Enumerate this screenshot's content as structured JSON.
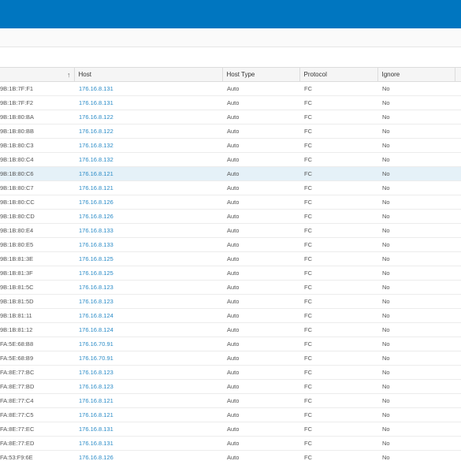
{
  "table": {
    "headers": {
      "port": "",
      "host": "Host",
      "host_type": "Host Type",
      "protocol": "Protocol",
      "ignore": "Ignore"
    },
    "rows": [
      {
        "port": "9B:1B:7F:F1",
        "host": "176.16.8.131",
        "host_type": "Auto",
        "protocol": "FC",
        "ignore": "No"
      },
      {
        "port": "9B:1B:7F:F2",
        "host": "176.16.8.131",
        "host_type": "Auto",
        "protocol": "FC",
        "ignore": "No"
      },
      {
        "port": "9B:1B:80:BA",
        "host": "176.16.8.122",
        "host_type": "Auto",
        "protocol": "FC",
        "ignore": "No"
      },
      {
        "port": "9B:1B:80:BB",
        "host": "176.16.8.122",
        "host_type": "Auto",
        "protocol": "FC",
        "ignore": "No"
      },
      {
        "port": "9B:1B:80:C3",
        "host": "176.16.8.132",
        "host_type": "Auto",
        "protocol": "FC",
        "ignore": "No"
      },
      {
        "port": "9B:1B:80:C4",
        "host": "176.16.8.132",
        "host_type": "Auto",
        "protocol": "FC",
        "ignore": "No"
      },
      {
        "port": "9B:1B:80:C6",
        "host": "176.16.8.121",
        "host_type": "Auto",
        "protocol": "FC",
        "ignore": "No",
        "selected": true
      },
      {
        "port": "9B:1B:80:C7",
        "host": "176.16.8.121",
        "host_type": "Auto",
        "protocol": "FC",
        "ignore": "No"
      },
      {
        "port": "9B:1B:80:CC",
        "host": "176.16.8.126",
        "host_type": "Auto",
        "protocol": "FC",
        "ignore": "No"
      },
      {
        "port": "9B:1B:80:CD",
        "host": "176.16.8.126",
        "host_type": "Auto",
        "protocol": "FC",
        "ignore": "No"
      },
      {
        "port": "9B:1B:80:E4",
        "host": "176.16.8.133",
        "host_type": "Auto",
        "protocol": "FC",
        "ignore": "No"
      },
      {
        "port": "9B:1B:80:E5",
        "host": "176.16.8.133",
        "host_type": "Auto",
        "protocol": "FC",
        "ignore": "No"
      },
      {
        "port": "9B:1B:81:3E",
        "host": "176.16.8.125",
        "host_type": "Auto",
        "protocol": "FC",
        "ignore": "No"
      },
      {
        "port": "9B:1B:81:3F",
        "host": "176.16.8.125",
        "host_type": "Auto",
        "protocol": "FC",
        "ignore": "No"
      },
      {
        "port": "9B:1B:81:5C",
        "host": "176.16.8.123",
        "host_type": "Auto",
        "protocol": "FC",
        "ignore": "No"
      },
      {
        "port": "9B:1B:81:5D",
        "host": "176.16.8.123",
        "host_type": "Auto",
        "protocol": "FC",
        "ignore": "No"
      },
      {
        "port": "9B:1B:81:11",
        "host": "176.16.8.124",
        "host_type": "Auto",
        "protocol": "FC",
        "ignore": "No"
      },
      {
        "port": "9B:1B:81:12",
        "host": "176.16.8.124",
        "host_type": "Auto",
        "protocol": "FC",
        "ignore": "No"
      },
      {
        "port": "FA:5E:68:B8",
        "host": "176.16.70.91",
        "host_type": "Auto",
        "protocol": "FC",
        "ignore": "No"
      },
      {
        "port": "FA:5E:68:B9",
        "host": "176.16.70.91",
        "host_type": "Auto",
        "protocol": "FC",
        "ignore": "No"
      },
      {
        "port": "FA:8E:77:BC",
        "host": "176.16.8.123",
        "host_type": "Auto",
        "protocol": "FC",
        "ignore": "No"
      },
      {
        "port": "FA:8E:77:BD",
        "host": "176.16.8.123",
        "host_type": "Auto",
        "protocol": "FC",
        "ignore": "No"
      },
      {
        "port": "FA:8E:77:C4",
        "host": "176.16.8.121",
        "host_type": "Auto",
        "protocol": "FC",
        "ignore": "No"
      },
      {
        "port": "FA:8E:77:C5",
        "host": "176.16.8.121",
        "host_type": "Auto",
        "protocol": "FC",
        "ignore": "No"
      },
      {
        "port": "FA:8E:77:EC",
        "host": "176.16.8.131",
        "host_type": "Auto",
        "protocol": "FC",
        "ignore": "No"
      },
      {
        "port": "FA:8E:77:ED",
        "host": "176.16.8.131",
        "host_type": "Auto",
        "protocol": "FC",
        "ignore": "No"
      },
      {
        "port": "FA:53:F9:6E",
        "host": "176.16.8.126",
        "host_type": "Auto",
        "protocol": "FC",
        "ignore": "No"
      }
    ]
  },
  "icons": {
    "sort": "sort-ascending-arrow-icon"
  },
  "colors": {
    "header_bar": "#0076c0",
    "host_link": "#2a8bc7",
    "selected_row": "#e5f1f8"
  }
}
